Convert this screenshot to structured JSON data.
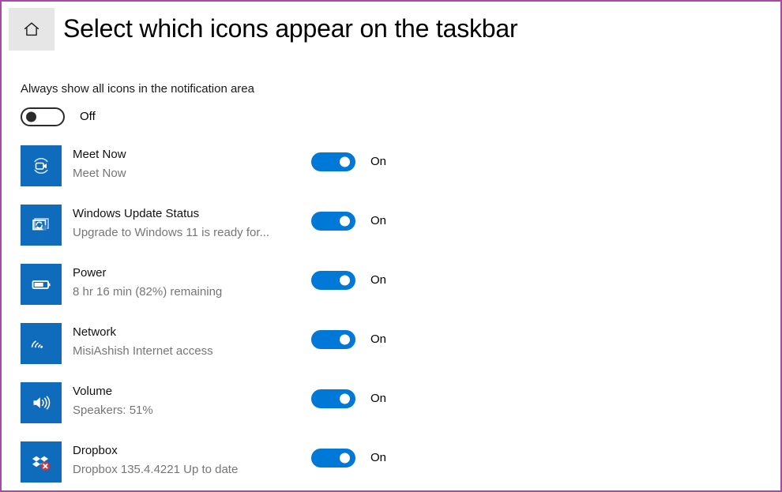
{
  "window": {
    "border_color": "#a54ba5",
    "background": "#ffffff"
  },
  "header": {
    "home_icon": "home-icon",
    "home_tooltip": "Home",
    "title": "Select which icons appear on the taskbar"
  },
  "master_setting": {
    "label": "Always show all icons in the notification area",
    "toggle_state": "off",
    "state_label": "Off"
  },
  "accent_color": "#0078d7",
  "tile_color": "#0f6cbd",
  "secondary_text_color": "#767676",
  "icons": [
    {
      "icon": "meet-now-icon",
      "title": "Meet Now",
      "subtitle": "Meet Now",
      "toggle_state": "on",
      "state_label": "On"
    },
    {
      "icon": "windows-update-status-icon",
      "title": "Windows Update Status",
      "subtitle": "Upgrade to Windows 11 is ready for...",
      "toggle_state": "on",
      "state_label": "On"
    },
    {
      "icon": "power-battery-icon",
      "title": "Power",
      "subtitle": "8 hr 16 min (82%) remaining",
      "toggle_state": "on",
      "state_label": "On"
    },
    {
      "icon": "network-wifi-icon",
      "title": "Network",
      "subtitle": "MisiAshish Internet access",
      "toggle_state": "on",
      "state_label": "On"
    },
    {
      "icon": "volume-speaker-icon",
      "title": "Volume",
      "subtitle": "Speakers: 51%",
      "toggle_state": "on",
      "state_label": "On"
    },
    {
      "icon": "dropbox-icon",
      "title": "Dropbox",
      "subtitle": "Dropbox 135.4.4221 Up to date",
      "toggle_state": "on",
      "state_label": "On"
    }
  ]
}
